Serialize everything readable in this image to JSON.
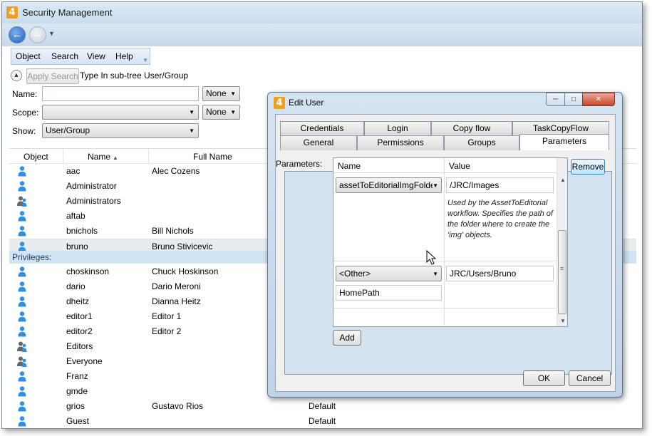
{
  "window": {
    "title": "Security Management",
    "app_logo": "4"
  },
  "menu": {
    "items": [
      "Object",
      "Search",
      "View",
      "Help"
    ]
  },
  "search": {
    "apply_label": "Apply Search",
    "subtree_label": "Type In sub-tree User/Group",
    "name_label": "Name:",
    "name_value": "",
    "name_filter": "None",
    "scope_label": "Scope:",
    "scope_value": "",
    "scope_filter": "None",
    "show_label": "Show:",
    "show_value": "User/Group"
  },
  "list": {
    "columns": [
      "Object",
      "Name",
      "Full Name"
    ],
    "privileges_label": "Privileges:",
    "rows_top": [
      {
        "type": "user",
        "login": "aac",
        "full_name": "Alec Cozens",
        "extra": ""
      },
      {
        "type": "user",
        "login": "Administrator",
        "full_name": "",
        "extra": ""
      },
      {
        "type": "group",
        "login": "Administrators",
        "full_name": "",
        "extra": ""
      },
      {
        "type": "user",
        "login": "aftab",
        "full_name": "",
        "extra": ""
      },
      {
        "type": "user",
        "login": "bnichols",
        "full_name": "Bill Nichols",
        "extra": ""
      },
      {
        "type": "user",
        "login": "bruno",
        "full_name": "Bruno Stivicevic",
        "extra": ""
      }
    ],
    "rows_bottom": [
      {
        "type": "user",
        "login": "choskinson",
        "full_name": "Chuck Hoskinson",
        "extra": ""
      },
      {
        "type": "user",
        "login": "dario",
        "full_name": "Dario Meroni",
        "extra": ""
      },
      {
        "type": "user",
        "login": "dheitz",
        "full_name": "Dianna Heitz",
        "extra": ""
      },
      {
        "type": "user",
        "login": "editor1",
        "full_name": "Editor 1",
        "extra": ""
      },
      {
        "type": "user",
        "login": "editor2",
        "full_name": "Editor 2",
        "extra": ""
      },
      {
        "type": "group",
        "login": "Editors",
        "full_name": "",
        "extra": ""
      },
      {
        "type": "group",
        "login": "Everyone",
        "full_name": "",
        "extra": ""
      },
      {
        "type": "user",
        "login": "Franz",
        "full_name": "",
        "extra": ""
      },
      {
        "type": "user",
        "login": "gmde",
        "full_name": "",
        "extra": ""
      },
      {
        "type": "user",
        "login": "grios",
        "full_name": "Gustavo Rios",
        "extra": "Default"
      },
      {
        "type": "user",
        "login": "Guest",
        "full_name": "",
        "extra": "Default"
      }
    ]
  },
  "dialog": {
    "title": "Edit User",
    "app_logo": "4",
    "tabs_row1": [
      "Credentials",
      "Login",
      "Copy flow",
      "TaskCopyFlow"
    ],
    "tabs_row2": [
      "General",
      "Permissions",
      "Groups",
      "Parameters"
    ],
    "active_tab": "Parameters",
    "params_label": "Parameters:",
    "grid": {
      "col_name": "Name",
      "col_value": "Value",
      "row1_name": "assetToEditorialImgFolder",
      "row1_value": "/JRC/Images",
      "row1_description": "Used by the AssetToEditorial workflow. Specifies the path of the folder where to create the 'img' objects.",
      "row2_name": "<Other>",
      "row2_value": "JRC/Users/Bruno",
      "row2_custom_name": "HomePath"
    },
    "remove_label": "Remove",
    "add_label": "Add",
    "ok_label": "OK",
    "cancel_label": "Cancel"
  },
  "colors": {
    "title_bar": "#c9dcee",
    "selection": "#e9ecef",
    "privileges_bar": "#d0e4f3",
    "user_icon": "#2f8fe0"
  }
}
